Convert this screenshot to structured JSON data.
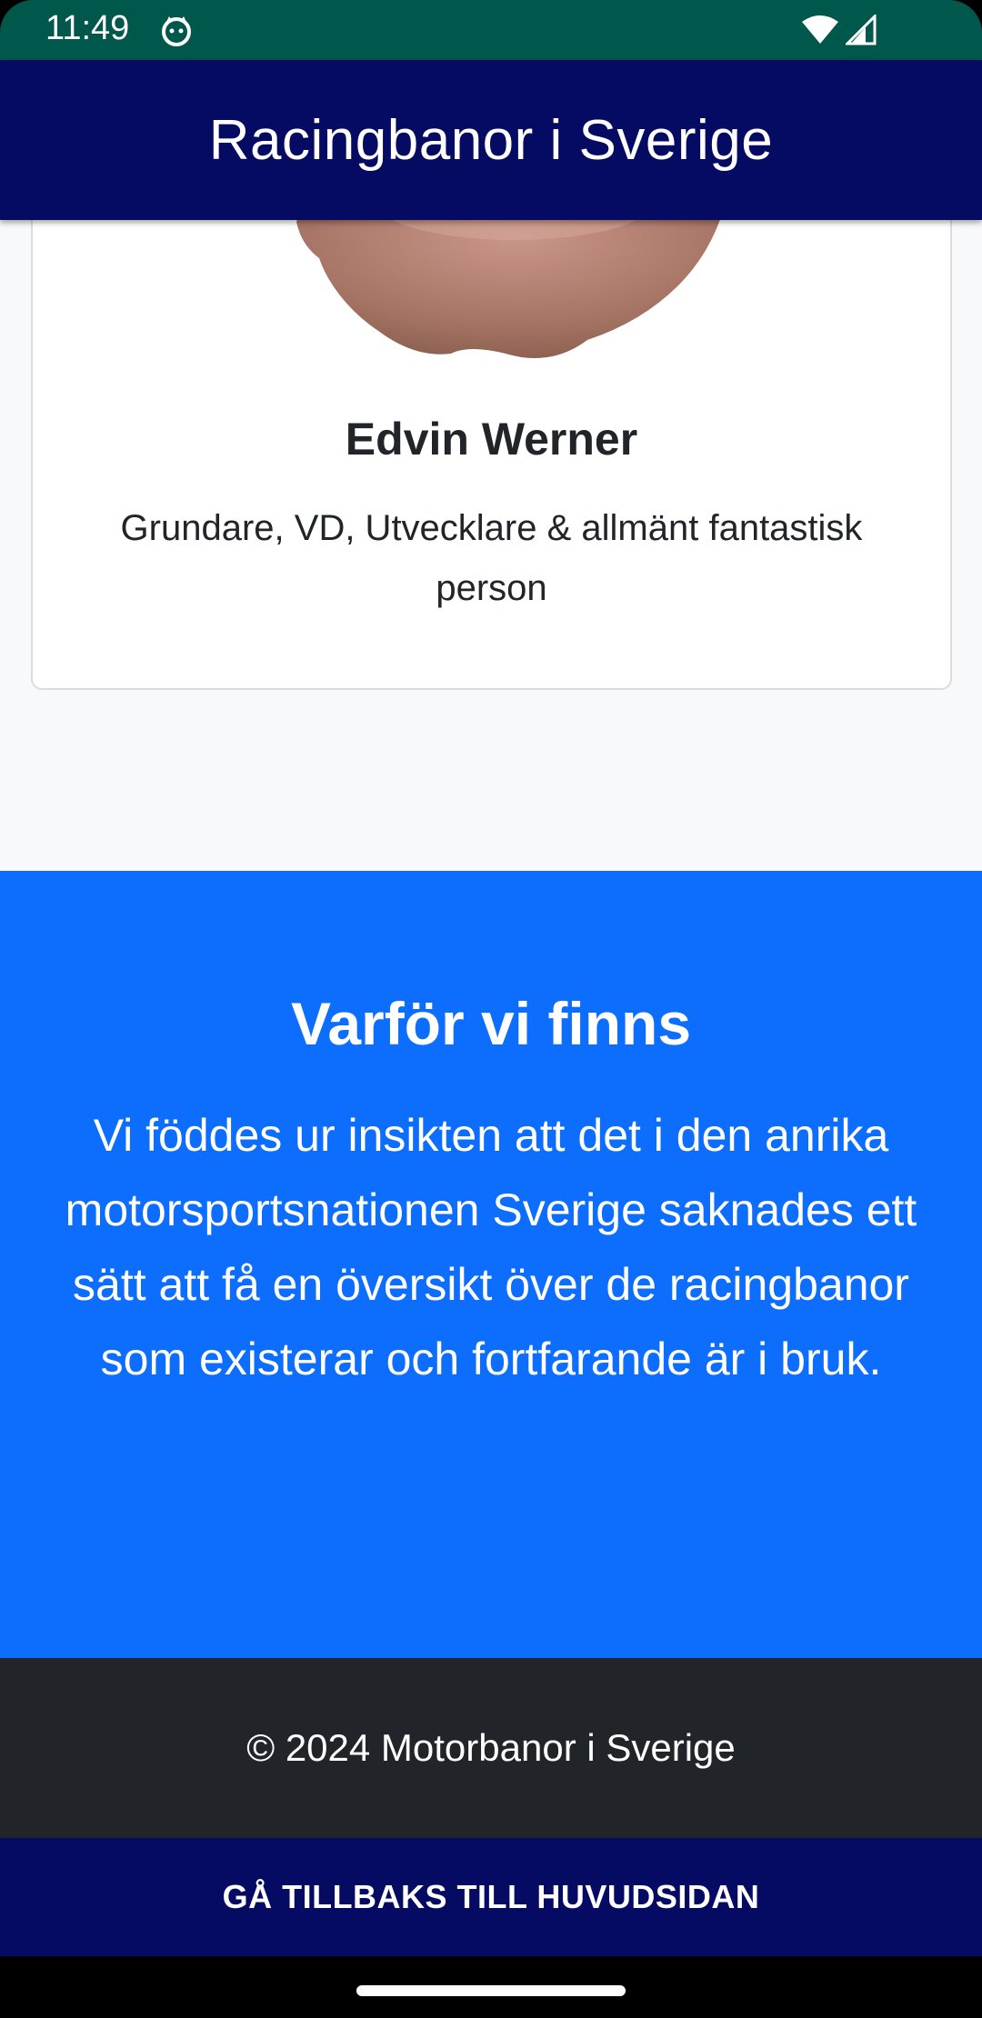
{
  "status_bar": {
    "time": "11:49",
    "icons": [
      "cat-notification-icon",
      "wifi-icon",
      "cell-signal-icon"
    ]
  },
  "app_bar": {
    "title": "Racingbanor i Sverige"
  },
  "team_card": {
    "name": "Edvin Werner",
    "role": "Grundare, VD, Utvecklare & allmänt fantastisk person"
  },
  "why_section": {
    "title": "Varför vi finns",
    "text": "Vi föddes ur insikten att det i den anrika motorsportsnationen Sverige saknades ett sätt att få en översikt över de racingbanor som existerar och fortfarande är i bruk."
  },
  "footer": {
    "text": "© 2024 Motorbanor i Sverige"
  },
  "back_button": {
    "label": "GÅ TILLBAKS TILL HUVUDSIDAN"
  },
  "colors": {
    "status_bar": "#00574b",
    "app_bar": "#050a63",
    "accent_blue": "#0d6efd",
    "footer": "#212529",
    "page_bg": "#f8f9fa"
  }
}
